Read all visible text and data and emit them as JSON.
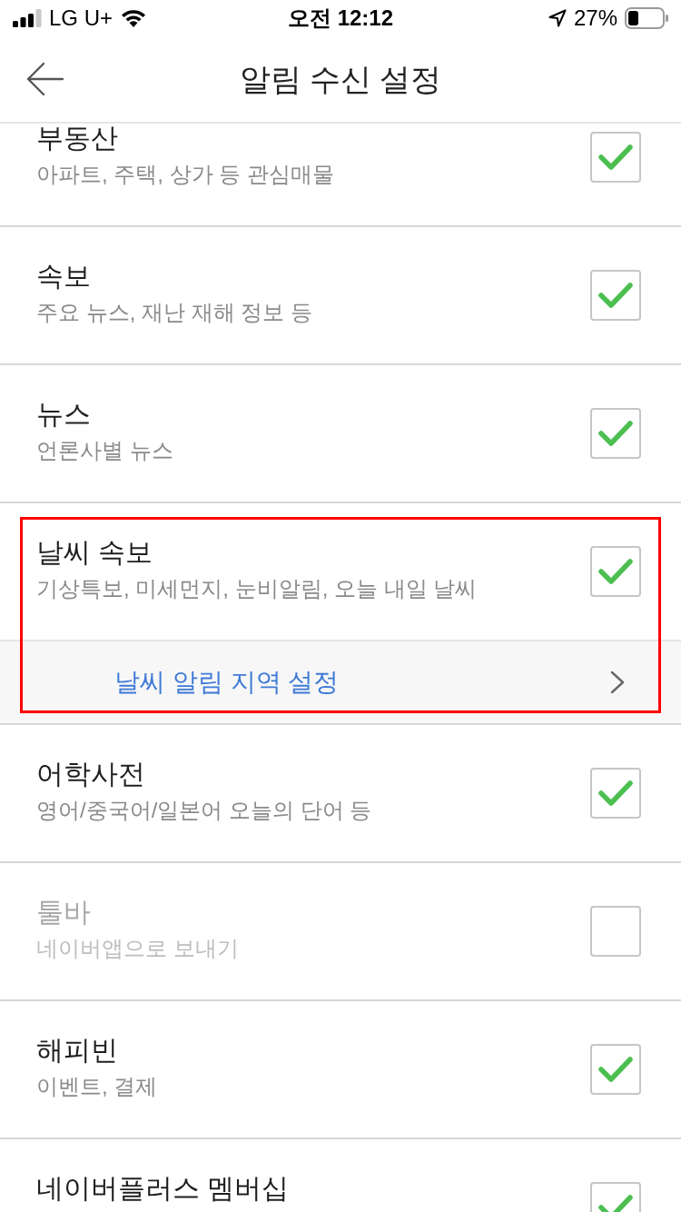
{
  "status_bar": {
    "carrier": "LG U+",
    "time": "오전 12:12",
    "battery": "27%"
  },
  "header": {
    "title": "알림 수신 설정"
  },
  "items": [
    {
      "title": "부동산",
      "subtitle": "아파트, 주택, 상가 등 관심매물",
      "checked": true,
      "highlighted": false
    },
    {
      "title": "속보",
      "subtitle": "주요 뉴스, 재난 재해 정보 등",
      "checked": true,
      "highlighted": false
    },
    {
      "title": "뉴스",
      "subtitle": "언론사별 뉴스",
      "checked": true,
      "highlighted": false
    },
    {
      "title": "날씨 속보",
      "subtitle": "기상특보, 미세먼지, 눈비알림, 오늘 내일 날씨",
      "checked": true,
      "highlighted": true,
      "link": {
        "label": "날씨 알림 지역 설정"
      }
    },
    {
      "title": "어학사전",
      "subtitle": "영어/중국어/일본어 오늘의 단어 등",
      "checked": true,
      "highlighted": false
    },
    {
      "title": "툴바",
      "subtitle": "네이버앱으로 보내기",
      "checked": false,
      "highlighted": false
    },
    {
      "title": "해피빈",
      "subtitle": "이벤트, 결제",
      "checked": true,
      "highlighted": false
    },
    {
      "title": "네이버플러스 멤버십",
      "checked": true,
      "highlighted": false
    }
  ]
}
